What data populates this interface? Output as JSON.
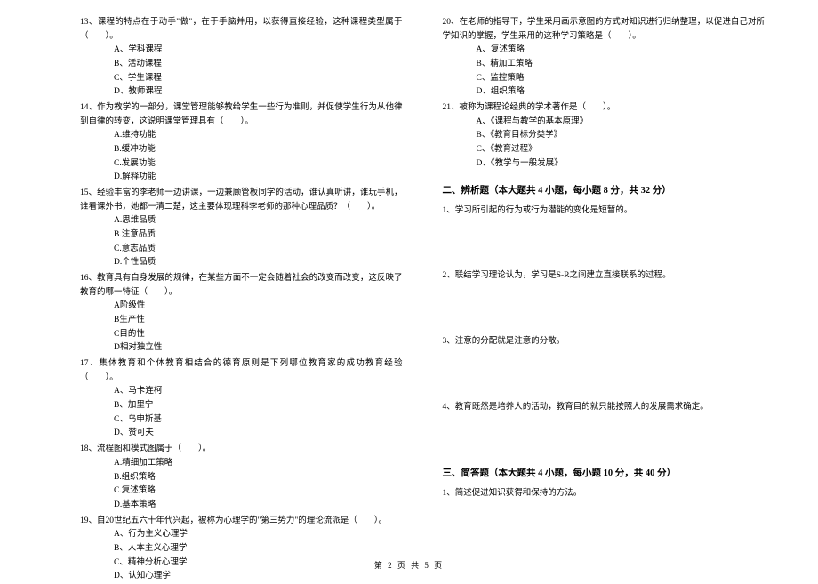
{
  "left_col": {
    "q13": {
      "stem": "13、课程的特点在于动手\"做\"，在于手脑并用，以获得直接经验，这种课程类型属于（　　）。",
      "opts": [
        "A、学科课程",
        "B、活动课程",
        "C、学生课程",
        "D、教师课程"
      ]
    },
    "q14": {
      "stem": "14、作为教学的一部分，课堂管理能够教给学生一些行为准则，并促使学生行为从他律到自律的转变，这说明课堂管理具有（　　）。",
      "opts": [
        "A.维持功能",
        "B.缓冲功能",
        "C.发展功能",
        "D.解释功能"
      ]
    },
    "q15": {
      "stem": "15、经验丰富的李老师一边讲课，一边兼顾管板同学的活动，谁认真听讲，谁玩手机，谁看课外书，她都一清二楚，这主要体现理科李老师的那种心理品质？（　　）。",
      "opts": [
        "A.思维品质",
        "B.注意品质",
        "C.意志品质",
        "D.个性品质"
      ]
    },
    "q16": {
      "stem": "16、教育具有自身发展的规律，在某些方面不一定会随着社会的改变而改变，这反映了教育的哪一特征（　　）。",
      "opts": [
        "A阶级性",
        "B生产性",
        "C目的性",
        "D相对独立性"
      ]
    },
    "q17": {
      "stem": "17、集体教育和个体教育相结合的德育原则是下列哪位教育家的成功教育经验（　　）。",
      "opts": [
        "A、马卡连柯",
        "B、加里宁",
        "C、乌申斯基",
        "D、赞可夫"
      ]
    },
    "q18": {
      "stem": "18、流程图和模式图属于（　　）。",
      "opts": [
        "A.精细加工策略",
        "B.组织策略",
        "C.复述策略",
        "D.基本策略"
      ]
    },
    "q19": {
      "stem": "19、自20世纪五六十年代兴起，被称为心理学的\"第三势力\"的理论流派是（　　）。",
      "opts": [
        "A、行为主义心理学",
        "B、人本主义心理学",
        "C、精神分析心理学",
        "D、认知心理学"
      ]
    }
  },
  "right_col": {
    "q20": {
      "stem": "20、在老师的指导下，学生采用画示意图的方式对知识进行归纳整理，以促进自己对所学知识的掌握，学生采用的这种学习策略是（　　）。",
      "opts": [
        "A、复述策略",
        "B、精加工策略",
        "C、监控策略",
        "D、组织策略"
      ]
    },
    "q21": {
      "stem": "21、被称为课程论经典的学术著作是（　　）。",
      "opts": [
        "A、《课程与教学的基本原理》",
        "B、《教育目标分类学》",
        "C、《教育过程》",
        "D、《教学与一般发展》"
      ]
    },
    "section2": {
      "title": "二、辨析题（本大题共 4 小题，每小题 8 分，共 32 分）",
      "items": [
        "1、学习所引起的行为或行为潜能的变化是短暂的。",
        "2、联结学习理论认为，学习是S-R之间建立直接联系的过程。",
        "3、注意的分配就是注意的分散。",
        "4、教育既然是培养人的活动，教育目的就只能按照人的发展需求确定。"
      ]
    },
    "section3": {
      "title": "三、简答题（本大题共 4 小题，每小题 10 分，共 40 分）",
      "items": [
        "1、简述促进知识获得和保持的方法。"
      ]
    }
  },
  "footer": "第 2 页 共 5 页"
}
